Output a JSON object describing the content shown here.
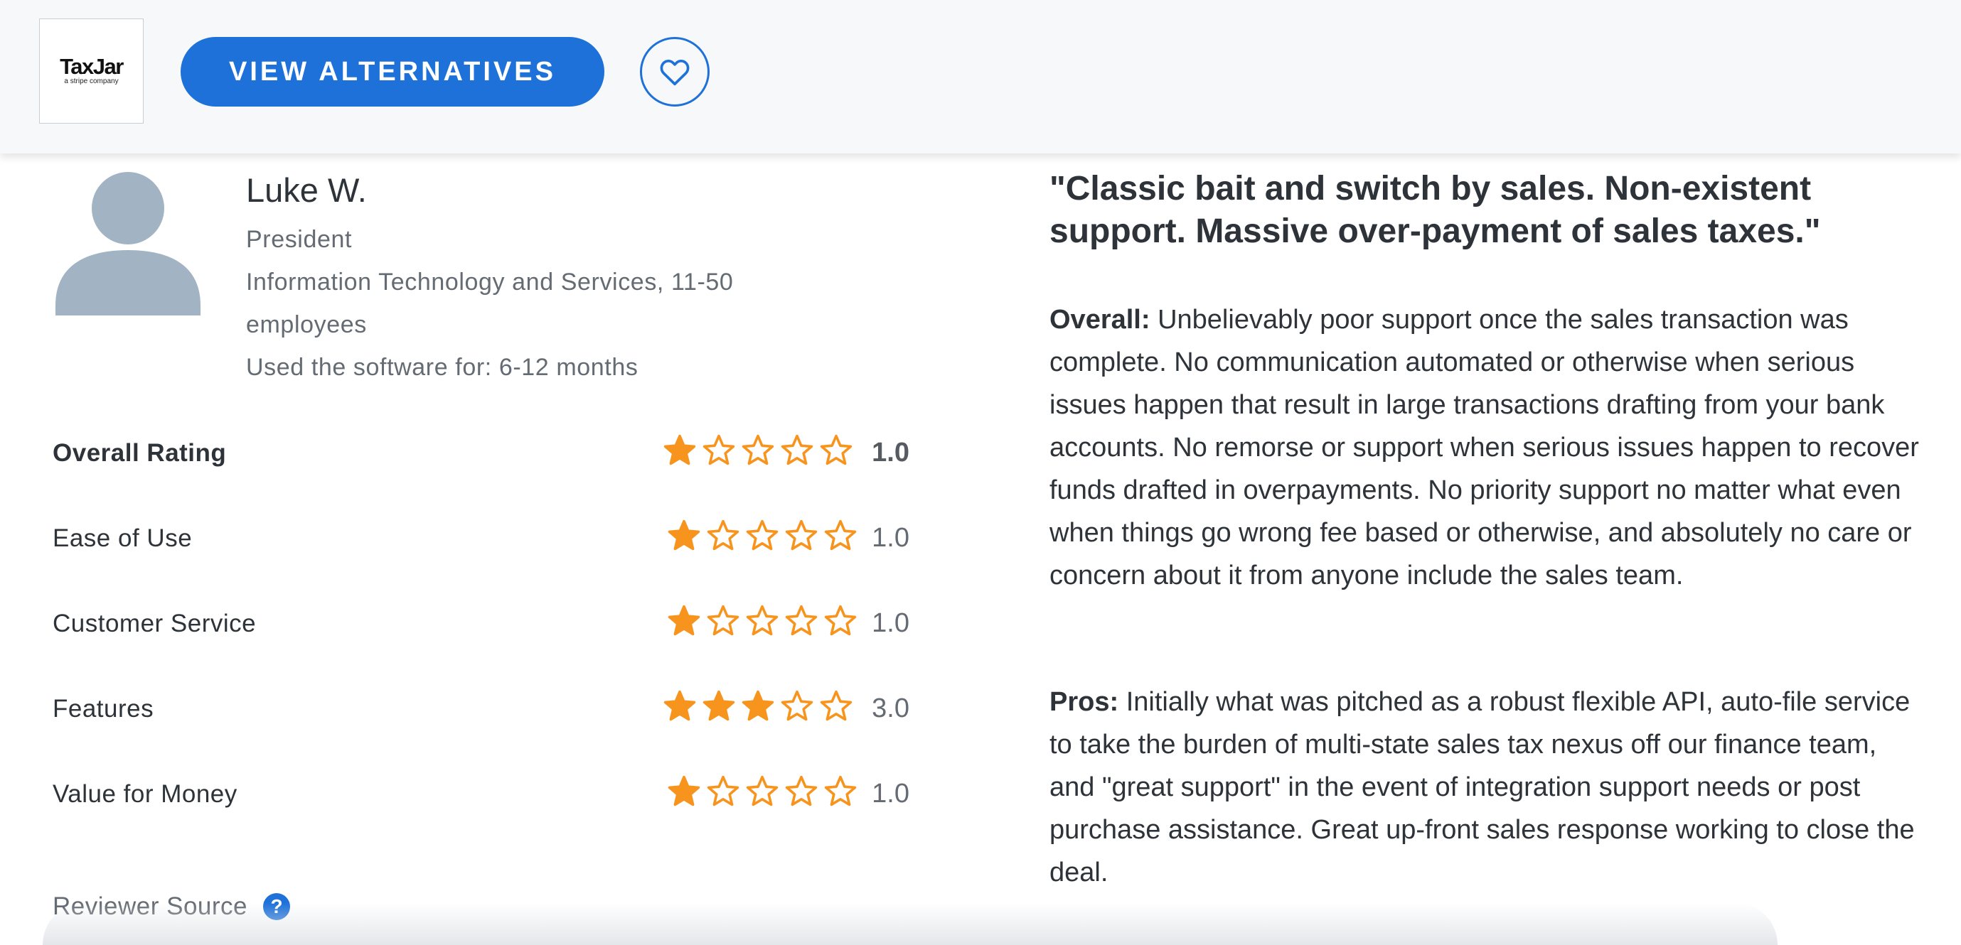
{
  "header": {
    "logo_name": "TaxJar",
    "logo_sub": "a stripe company",
    "view_alternatives_label": "VIEW ALTERNATIVES",
    "favorite_icon": "heart-icon",
    "accent_color": "#1d71d9"
  },
  "reviewer": {
    "name": "Luke W.",
    "title": "President",
    "industry_line1": "Information Technology and Services, 11-50",
    "industry_line2": "employees",
    "usage": "Used the software for: 6-12 months",
    "avatar_icon": "user-avatar-icon"
  },
  "ratings": {
    "star_color": "#f7941d",
    "items": [
      {
        "label": "Overall Rating",
        "stars": 1,
        "value": "1.0"
      },
      {
        "label": "Ease of Use",
        "stars": 1,
        "value": "1.0"
      },
      {
        "label": "Customer Service",
        "stars": 1,
        "value": "1.0"
      },
      {
        "label": "Features",
        "stars": 3,
        "value": "3.0"
      },
      {
        "label": "Value for Money",
        "stars": 1,
        "value": "1.0"
      }
    ]
  },
  "source": {
    "label": "Reviewer Source",
    "help_glyph": "?"
  },
  "review": {
    "title": "\"Classic bait and switch by sales. Non-existent support. Massive over-payment of sales taxes.\"",
    "overall_label": "Overall:",
    "overall_text": " Unbelievably poor support once the sales transaction was complete. No communication automated or otherwise when serious issues happen that result in large transactions drafting from your bank accounts. No remorse or support when serious issues happen to recover funds drafted in overpayments. No priority support no matter what even when things go wrong fee based or otherwise, and absolutely no care or concern about it from anyone include the sales team.",
    "pros_label": "Pros:",
    "pros_text": " Initially what was pitched as a robust flexible API, auto-file service to take the burden of multi-state sales tax nexus off our finance team, and \"great support\" in the event of integration support needs or post purchase assistance. Great up-front sales response working to close the deal."
  }
}
